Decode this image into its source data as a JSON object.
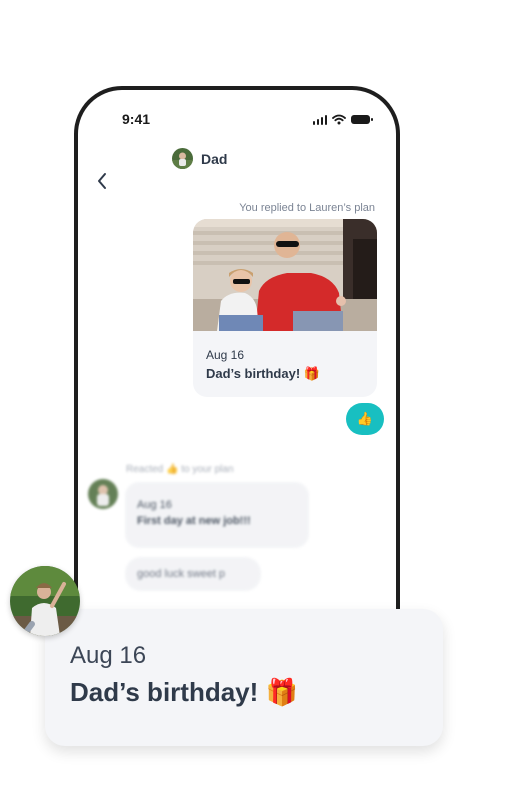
{
  "status_bar": {
    "time": "9:41",
    "icons": [
      "signal-icon",
      "wifi-icon",
      "battery-icon"
    ]
  },
  "header": {
    "contact_name": "Dad",
    "back_icon": "chevron-left-icon"
  },
  "thread": {
    "reply_note": "You replied to Lauren’s plan",
    "plan_card": {
      "date": "Aug 16",
      "title": "Dad’s birthday!",
      "title_emoji": "🎁"
    },
    "reaction": {
      "emoji": "👍",
      "icon": "thumbs-up-icon",
      "color": "#18bfc1"
    },
    "incoming": {
      "reacted_note": "Reacted 👍 to your plan",
      "plan_date": "Aug 16",
      "plan_title": "First day at new job!!!",
      "message": "good luck sweet p"
    }
  },
  "overlay_card": {
    "date": "Aug 16",
    "title": "Dad’s birthday!",
    "title_emoji": "🎁"
  },
  "colors": {
    "accent": "#18bfc1",
    "text_dark": "#2f3a4a",
    "card_bg": "#f4f5f8"
  }
}
